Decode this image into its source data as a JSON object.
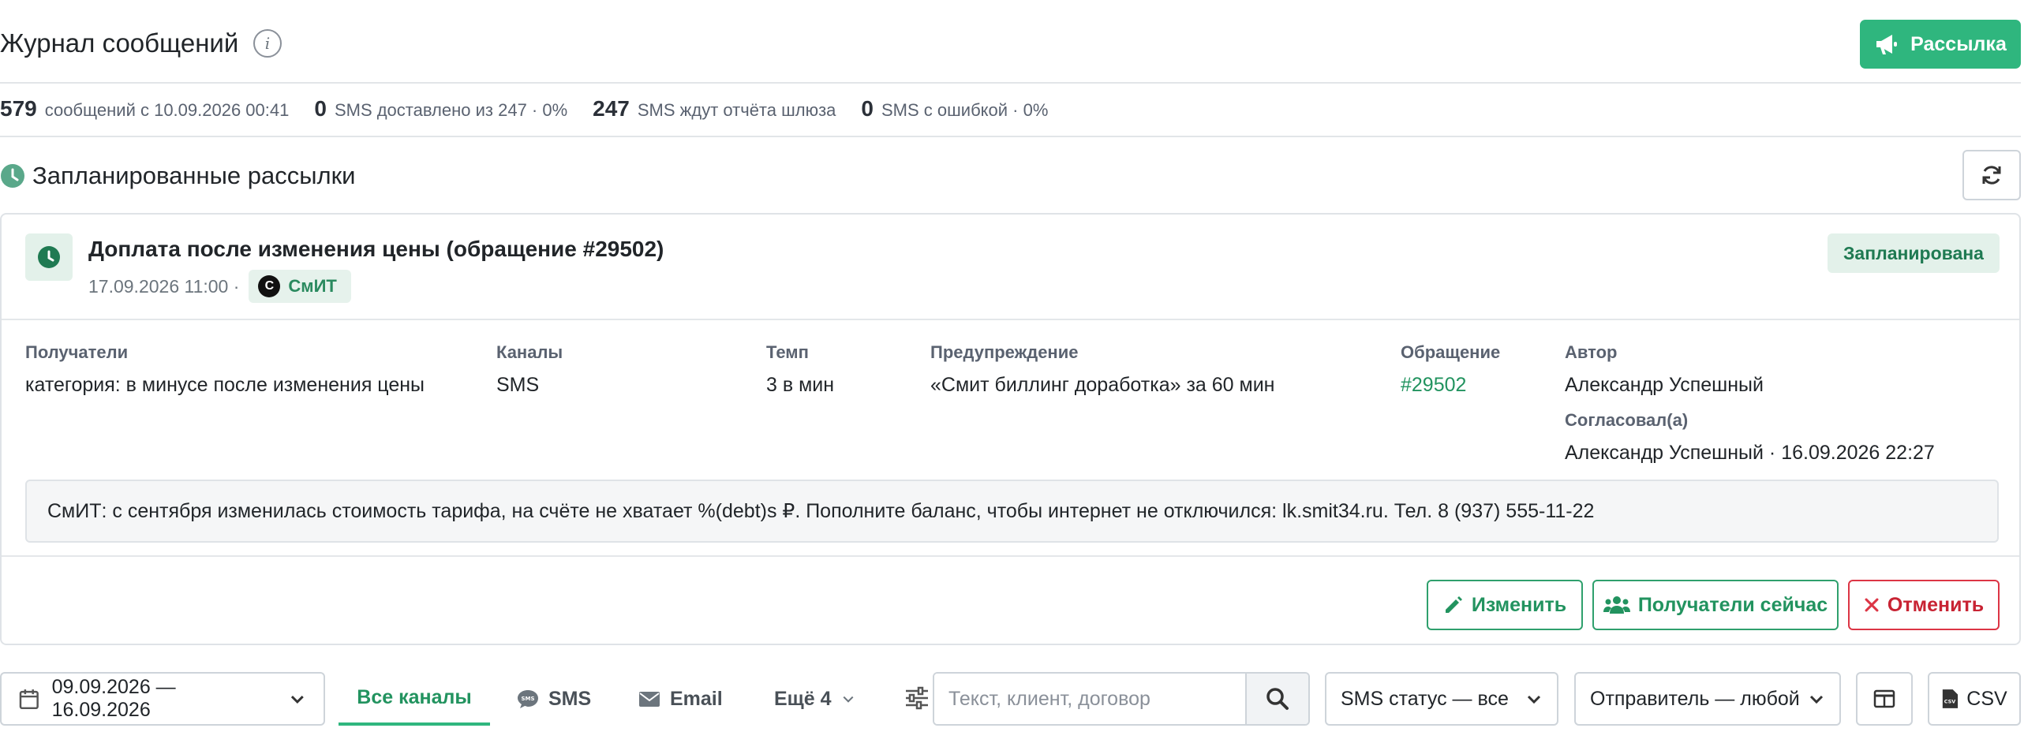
{
  "header": {
    "title": "Журнал сообщений",
    "info_icon": "info-icon",
    "broadcast_label": "Рассылка"
  },
  "stats": [
    {
      "num": "579",
      "label": "сообщений с 10.09.2026 00:41"
    },
    {
      "num": "0",
      "label": "SMS доставлено из 247 · 0%"
    },
    {
      "num": "247",
      "label": "SMS ждут отчёта шлюза"
    },
    {
      "num": "0",
      "label": "SMS с ошибкой · 0%"
    }
  ],
  "scheduled": {
    "title": "Запланированные рассылки",
    "card": {
      "title": "Доплата после изменения цены (обращение #29502)",
      "datetime": "17.09.2026 11:00 ·",
      "brand_logo_letter": "С",
      "brand": "СмИТ",
      "status": "Запланирована",
      "fields": {
        "recipients": {
          "label": "Получатели",
          "value": "категория: в минусе после изменения цены"
        },
        "channels": {
          "label": "Каналы",
          "value": "SMS"
        },
        "tempo": {
          "label": "Темп",
          "value": "3 в мин"
        },
        "warning": {
          "label": "Предупреждение",
          "value": "«Смит биллинг доработка» за 60 мин"
        },
        "ticket": {
          "label": "Обращение",
          "value": "#29502"
        },
        "author": {
          "label": "Автор",
          "value": "Александр Успешный"
        },
        "approved": {
          "label": "Согласовал(а)",
          "value": "Александр Успешный · 16.09.2026 22:27"
        }
      },
      "message": "СмИТ: с сентября изменилась стоимость тарифа, на счёте не хватает %(debt)s ₽. Пополните баланс, чтобы интернет не отключился: lk.smit34.ru. Тел. 8 (937) 555-11-22",
      "actions": {
        "edit": "Изменить",
        "recipients_now": "Получатели сейчас",
        "cancel": "Отменить"
      }
    }
  },
  "filters": {
    "date_range": "09.09.2026 — 16.09.2026",
    "tabs": {
      "all": "Все каналы",
      "sms": "SMS",
      "email": "Email",
      "more": "Ещё 4"
    },
    "search_placeholder": "Текст, клиент, договор",
    "sms_status": "SMS статус — все",
    "sender": "Отправитель — любой",
    "csv": "CSV"
  },
  "colors": {
    "accent": "#2fb67e",
    "accent_dark": "#22935f",
    "danger": "#dc3545",
    "badge_bg": "#e3f1ea"
  }
}
